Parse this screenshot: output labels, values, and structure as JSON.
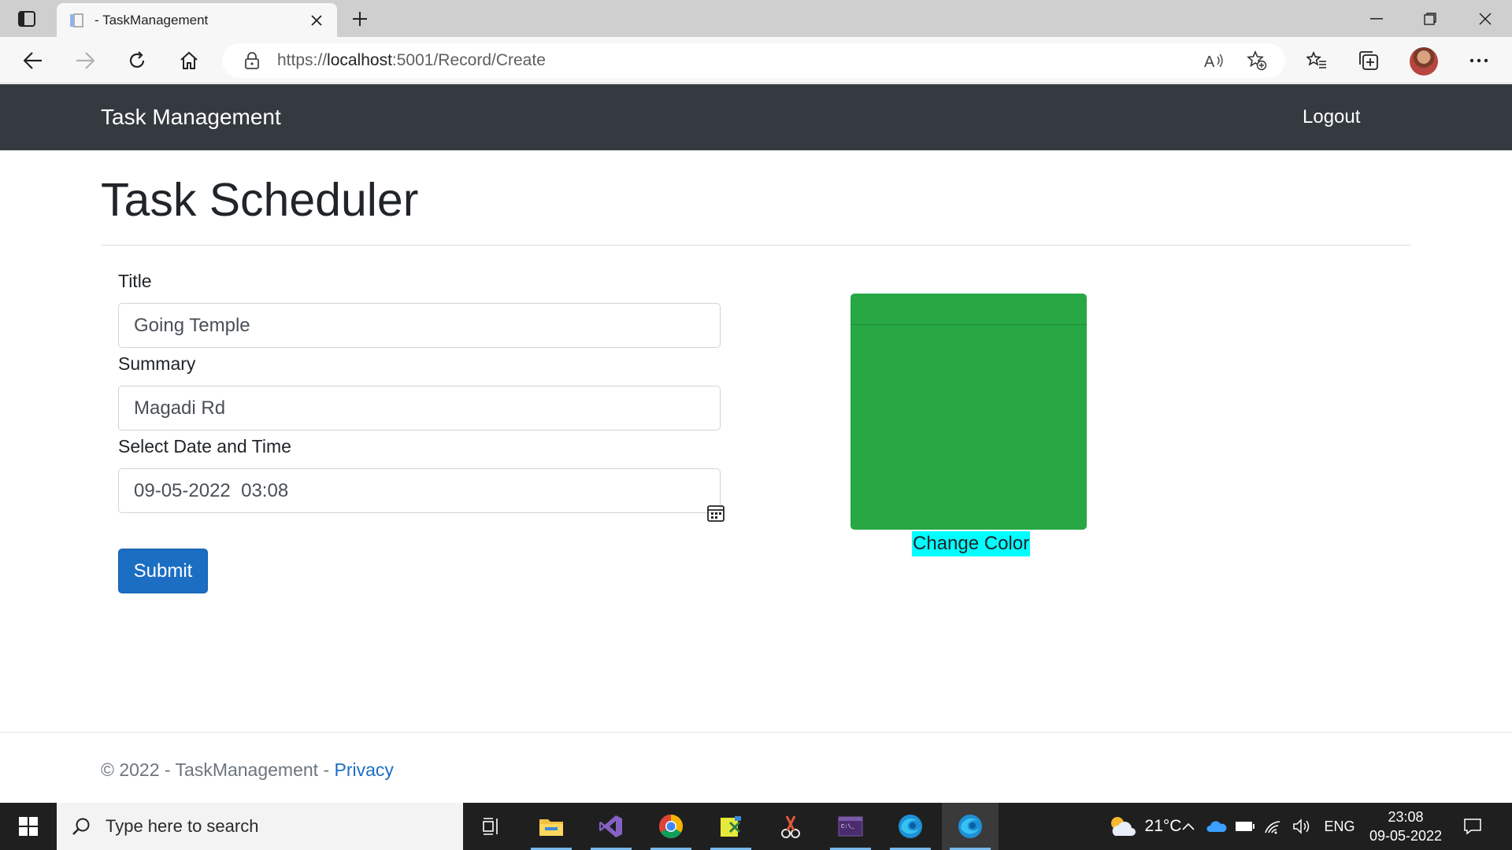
{
  "browser": {
    "tab_title": "- TaskManagement",
    "url_prefix": "https://",
    "url_host": "localhost",
    "url_path": ":5001/Record/Create"
  },
  "site": {
    "brand": "Task Management",
    "logout": "Logout"
  },
  "page": {
    "title": "Task Scheduler",
    "form": {
      "title_label": "Title",
      "title_value": "Going Temple",
      "summary_label": "Summary",
      "summary_value": "Magadi Rd",
      "datetime_label": "Select Date and Time",
      "datetime_value": "09-05-2022  03:08",
      "submit_label": "Submit"
    },
    "color_box": {
      "color": "#28a745",
      "button_label": "Change Color",
      "button_bg": "#00ffff"
    }
  },
  "footer": {
    "text": "© 2022 - TaskManagement - ",
    "privacy_link": "Privacy"
  },
  "taskbar": {
    "search_placeholder": "Type here to search",
    "temperature": "21°C",
    "language": "ENG",
    "time": "23:08",
    "date": "09-05-2022"
  },
  "colors": {
    "navbar_bg": "#343a40",
    "primary": "#1b6ec2",
    "box_green": "#28a745"
  }
}
